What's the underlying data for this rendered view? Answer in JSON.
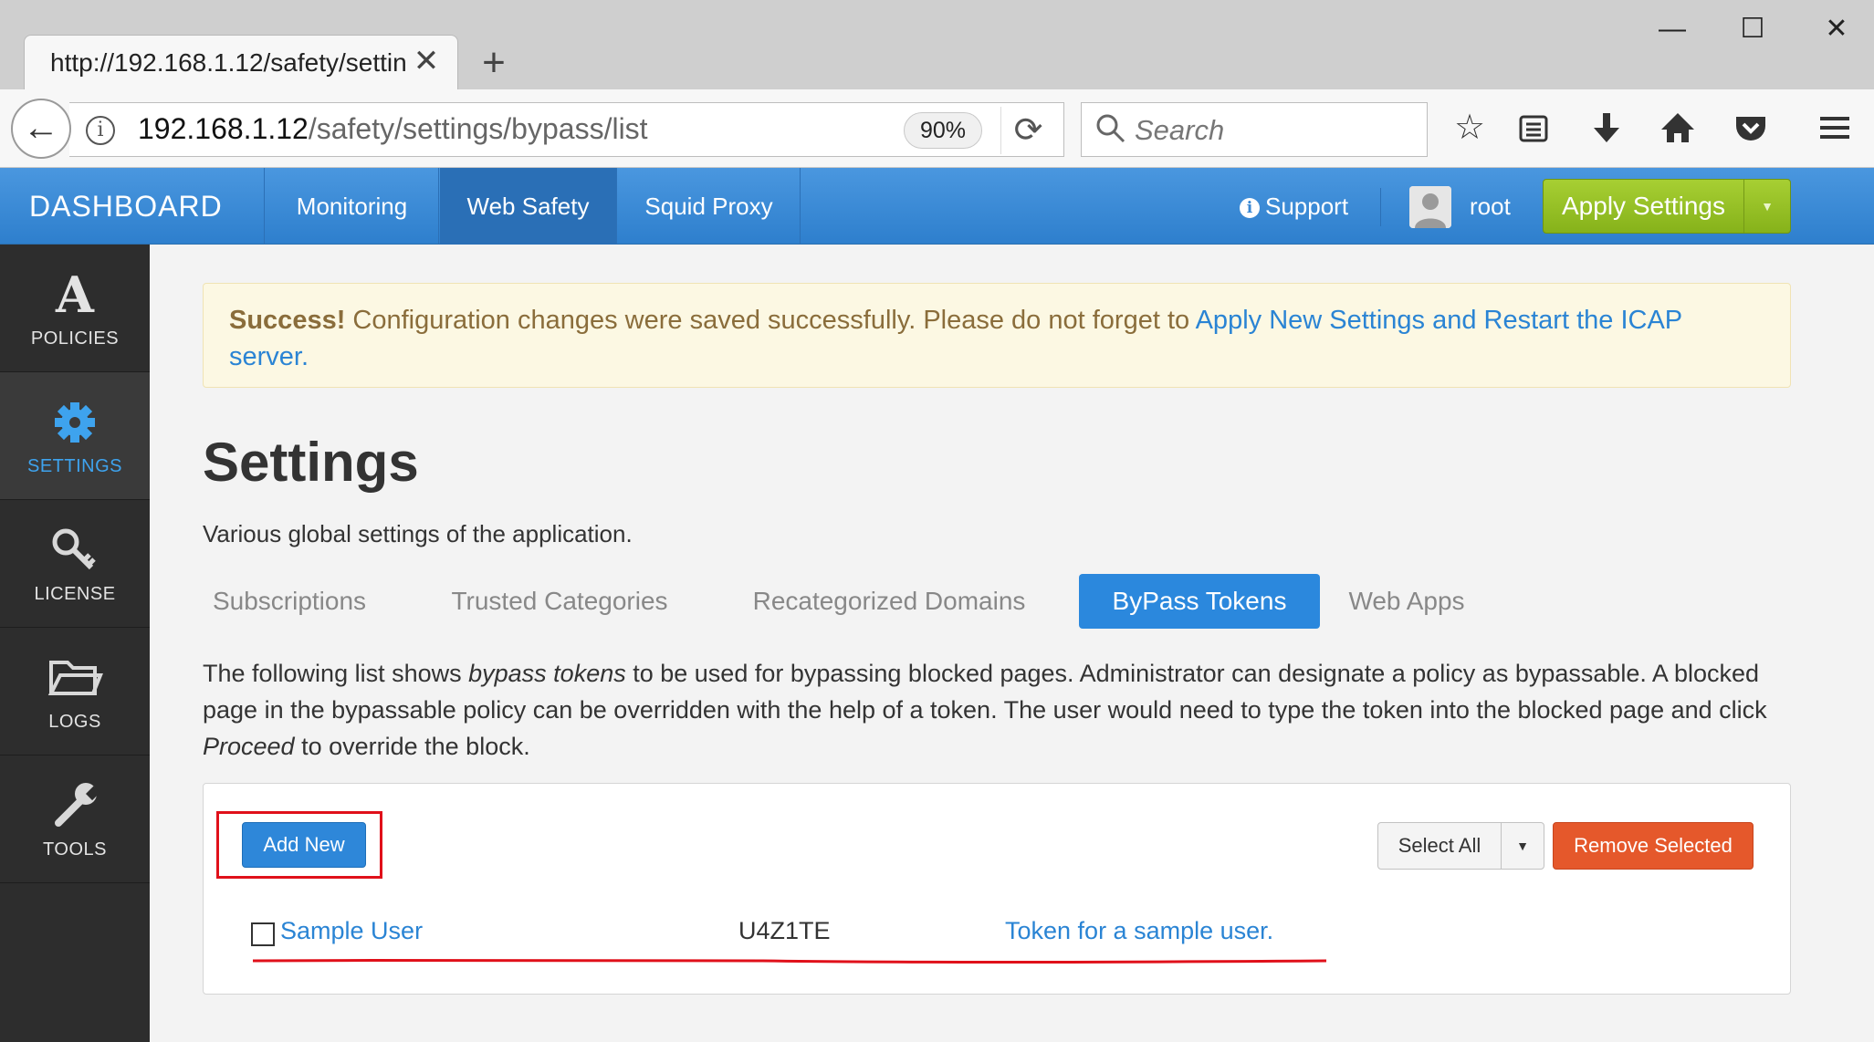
{
  "browser": {
    "tab_title": "http://192.168.1.12/safety/settin",
    "url_host": "192.168.1.12",
    "url_path": "/safety/settings/bypass/list",
    "zoom": "90%",
    "search_placeholder": "Search"
  },
  "header": {
    "brand": "DASHBOARD",
    "nav": [
      "Monitoring",
      "Web Safety",
      "Squid Proxy"
    ],
    "active_nav": "Web Safety",
    "support": "Support",
    "user": "root",
    "apply": "Apply Settings"
  },
  "sidebar": {
    "items": [
      {
        "label": "POLICIES",
        "icon": "policies-icon"
      },
      {
        "label": "SETTINGS",
        "icon": "gear-icon"
      },
      {
        "label": "LICENSE",
        "icon": "key-icon"
      },
      {
        "label": "LOGS",
        "icon": "folder-icon"
      },
      {
        "label": "TOOLS",
        "icon": "wrench-icon"
      }
    ],
    "active": "SETTINGS"
  },
  "alert": {
    "strong": "Success!",
    "text": " Configuration changes were saved successfully. Please do not forget to ",
    "link": "Apply New Settings and Restart the ICAP server."
  },
  "page": {
    "title": "Settings",
    "subtitle": "Various global settings of the application.",
    "tabs": [
      "Subscriptions",
      "Trusted Categories",
      "Recategorized Domains",
      "ByPass Tokens",
      "Web Apps"
    ],
    "active_tab": "ByPass Tokens",
    "description": {
      "p1": "The following list shows ",
      "em1": "bypass tokens",
      "p2": " to be used for bypassing blocked pages. Administrator can designate a policy as bypassable. A blocked page in the bypassable policy can be overridden with the help of a token. The user would need to type the token into the blocked page and click ",
      "em2": "Proceed",
      "p3": " to override the block."
    }
  },
  "toolbar": {
    "add_new": "Add New",
    "select_all": "Select All",
    "remove_selected": "Remove Selected"
  },
  "tokens": [
    {
      "name": "Sample User",
      "token": "U4Z1TE",
      "comment": "Token for a sample user."
    }
  ],
  "colors": {
    "header_blue": "#3a88d4",
    "apply_green": "#94be22",
    "remove_orange": "#e5582b",
    "highlight_red": "#e0101a"
  }
}
